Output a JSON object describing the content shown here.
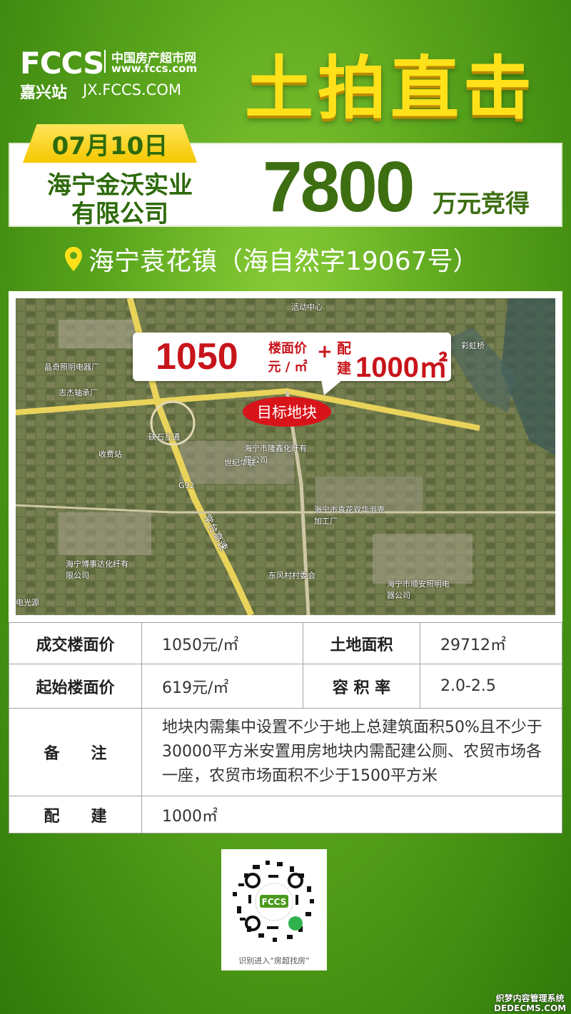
{
  "header": {
    "logo_mark": "FCCS",
    "site_name": "中国房产超市网",
    "site_url": "www.fccs.com",
    "station": "嘉兴站",
    "station_url": "JX.FCCS.COM",
    "headline": "土拍直击"
  },
  "result": {
    "date": "07月10日",
    "winner_line1": "海宁金沃实业",
    "winner_line2": "有限公司",
    "amount": "7800",
    "amount_unit": "万元竞得"
  },
  "location": {
    "icon": "pin-icon",
    "text": "海宁袁花镇（海自然字19067号）"
  },
  "map": {
    "callout": {
      "price": "1050",
      "price_unit_line1": "楼面价",
      "price_unit_line2": "元 / ㎡",
      "plus": "+",
      "supporting_label_line1": "配",
      "supporting_label_line2": "建",
      "supporting_area": "1000㎡"
    },
    "target": "目标地块",
    "labels": {
      "activity_center": "活动中心",
      "caihong_bridge": "彩虹桥",
      "jingqi": "晶奇照明电器厂",
      "zhijie": "志杰轴承厂",
      "xiashi": "硖石互通",
      "toll": "收费站",
      "longxin": "海宁市隆鑫化纤有限公司",
      "shiji": "世纪华联",
      "g92": "G92",
      "shuanghua": "海宁市袁花双华泡壳加工厂",
      "changtai": "常台高速",
      "boshida": "海宁博事达化纤有限公司",
      "dongfeng": "东风村村委会",
      "shunan": "海宁市顺安照明电器公司",
      "dianguangyuan": "电光源"
    }
  },
  "table": {
    "deal_price_label": "成交楼面价",
    "deal_price_value": "1050元/㎡",
    "land_area_label": "土地面积",
    "land_area_value": "29712㎡",
    "start_price_label": "起始楼面价",
    "start_price_value": "619元/㎡",
    "plot_ratio_label": "容 积 率",
    "plot_ratio_value": "2.0-2.5",
    "remark_label": "备　　注",
    "remark_value": "地块内需集中设置不少于地上总建筑面积50%且不少于30000平方米安置用房地块内需配建公厕、农贸市场各一座，农贸市场面积不少于1500平方米",
    "supporting_label": "配　　建",
    "supporting_value": "1000㎡"
  },
  "qr": {
    "caption": "识别进入“房超找房”"
  },
  "watermark": {
    "line1": "织梦内容管理系统",
    "line2": "DEDECMS.COM"
  },
  "colors": {
    "headline": "#ffe11a",
    "dark_green": "#2e6a0b",
    "price_red": "#c8141b",
    "background_green": "#5aa51c"
  }
}
